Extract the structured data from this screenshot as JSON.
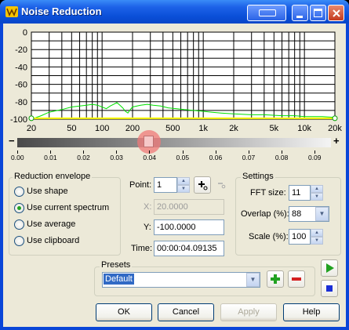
{
  "window": {
    "title": "Noise Reduction"
  },
  "chart_data": {
    "type": "line",
    "x_axis": {
      "scale": "log",
      "range": [
        20,
        20000
      ],
      "tick_labels": [
        "20",
        "50",
        "100",
        "200",
        "500",
        "1k",
        "2k",
        "5k",
        "10k",
        "20k"
      ]
    },
    "y_axis": {
      "range": [
        -100,
        0
      ],
      "tick_labels": [
        "0",
        "-20",
        "-40",
        "-60",
        "-80",
        "-100"
      ]
    },
    "grid": true,
    "background": "#ffffff",
    "grid_color": "#000000",
    "series": [
      {
        "color": "#00e000",
        "x": [
          20,
          25,
          30,
          40,
          50,
          60,
          70,
          80,
          90,
          100,
          110,
          120,
          130,
          140,
          150,
          160,
          170,
          180,
          190,
          200,
          240,
          280,
          320,
          380,
          450,
          550,
          650,
          800,
          1000,
          1200,
          1500,
          2000,
          3000,
          4000,
          6000,
          8000,
          10000,
          15000,
          20000
        ],
        "y": [
          -100,
          -96,
          -92,
          -89,
          -86,
          -85,
          -84,
          -83,
          -84,
          -86,
          -88,
          -85,
          -83,
          -81,
          -84,
          -87,
          -91,
          -93,
          -89,
          -86,
          -84,
          -83,
          -84,
          -85,
          -87,
          -88,
          -89,
          -90,
          -91,
          -92,
          -93,
          -94,
          -95,
          -95,
          -96,
          -96,
          -97,
          -97,
          -98
        ]
      },
      {
        "color": "#ffff00",
        "x": [
          20,
          20000
        ],
        "y": [
          -99,
          -99
        ]
      }
    ]
  },
  "slider": {
    "minus": "−",
    "plus": "+",
    "value": 0.04,
    "tick_labels": [
      "0.00",
      "0.01",
      "0.02",
      "0.03",
      "0.04",
      "0.05",
      "0.06",
      "0.07",
      "0.08",
      "0.09"
    ]
  },
  "reduction_envelope": {
    "title": "Reduction envelope",
    "options": [
      "Use shape",
      "Use current spectrum",
      "Use average",
      "Use clipboard"
    ],
    "selected": "Use current spectrum"
  },
  "point_panel": {
    "point_label": "Point:",
    "point_value": "1",
    "x_label": "X:",
    "x_value": "20.0000",
    "y_label": "Y:",
    "y_value": "-100.0000",
    "time_label": "Time:",
    "time_value": "00:00:04.09135"
  },
  "settings": {
    "title": "Settings",
    "fft_size_label": "FFT size:",
    "fft_size_value": "11",
    "overlap_label": "Overlap (%):",
    "overlap_value": "88",
    "scale_label": "Scale (%):",
    "scale_value": "100"
  },
  "presets": {
    "title": "Presets",
    "selected": "Default"
  },
  "buttons": {
    "ok": "OK",
    "cancel": "Cancel",
    "apply": "Apply",
    "help": "Help"
  },
  "colors": {
    "play": "#21a121",
    "stop": "#1a2ed6",
    "add": "#21a121",
    "remove": "#d42020"
  }
}
